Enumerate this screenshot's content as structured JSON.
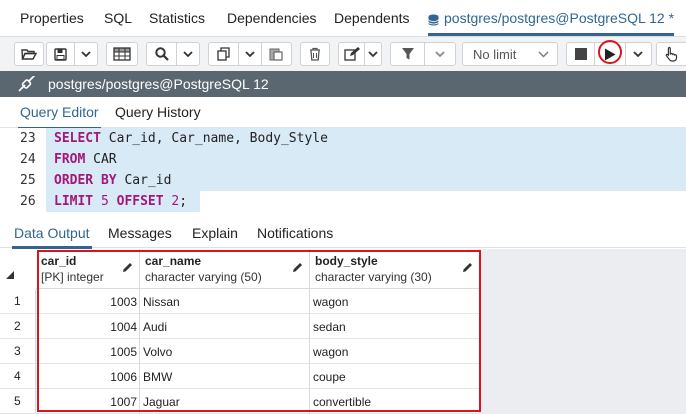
{
  "tabs": [
    {
      "label": "Properties"
    },
    {
      "label": "SQL"
    },
    {
      "label": "Statistics"
    },
    {
      "label": "Dependencies"
    },
    {
      "label": "Dependents"
    },
    {
      "label": "postgres/postgres@PostgreSQL 12 *"
    }
  ],
  "toolbar": {
    "limit_label": "No limit",
    "icons": [
      "open-file-icon",
      "save-icon",
      "save-dropdown-icon",
      "table-grid-icon",
      "search-icon",
      "search-dropdown-icon",
      "copy-icon",
      "copy-dropdown-icon",
      "paste-icon",
      "delete-icon",
      "edit-icon",
      "edit-dropdown-icon",
      "filter-icon",
      "filter-dropdown-icon",
      "stop-icon",
      "execute-icon",
      "execute-dropdown-icon",
      "pointer-icon"
    ]
  },
  "connection": {
    "label": "postgres/postgres@PostgreSQL 12"
  },
  "editor_tabs": [
    {
      "label": "Query Editor"
    },
    {
      "label": "Query History"
    }
  ],
  "editor": {
    "lines": [
      {
        "number": "23",
        "tokens": [
          {
            "kw": "SELECT"
          },
          {
            "t": " Car_id, Car_name, Body_Style"
          }
        ]
      },
      {
        "number": "24",
        "tokens": [
          {
            "kw": "FROM"
          },
          {
            "t": " CAR"
          }
        ]
      },
      {
        "number": "25",
        "tokens": [
          {
            "kw": "ORDER BY"
          },
          {
            "t": " Car_id"
          }
        ]
      },
      {
        "number": "26",
        "tokens": [
          {
            "kw": "LIMIT"
          },
          {
            "t": " "
          },
          {
            "n": "5"
          },
          {
            "t": " "
          },
          {
            "kw": "OFFSET"
          },
          {
            "t": " "
          },
          {
            "n": "2"
          },
          {
            "t": ";"
          }
        ]
      }
    ]
  },
  "output_tabs": [
    {
      "label": "Data Output"
    },
    {
      "label": "Messages"
    },
    {
      "label": "Explain"
    },
    {
      "label": "Notifications"
    }
  ],
  "grid": {
    "columns": [
      {
        "name": "car_id",
        "type": "[PK] integer"
      },
      {
        "name": "car_name",
        "type": "character varying (50)"
      },
      {
        "name": "body_style",
        "type": "character varying (30)"
      }
    ],
    "rows": [
      {
        "n": "1",
        "car_id": "1003",
        "car_name": "Nissan",
        "body_style": "wagon"
      },
      {
        "n": "2",
        "car_id": "1004",
        "car_name": "Audi",
        "body_style": "sedan"
      },
      {
        "n": "3",
        "car_id": "1005",
        "car_name": "Volvo",
        "body_style": "wagon"
      },
      {
        "n": "4",
        "car_id": "1006",
        "car_name": "BMW",
        "body_style": "coupe"
      },
      {
        "n": "5",
        "car_id": "1007",
        "car_name": "Jaguar",
        "body_style": "convertible"
      }
    ]
  },
  "colors": {
    "accent": "#326690",
    "highlight": "#d9141c",
    "connection_bar": "#5b6770",
    "keyword": "#a2187a",
    "selection": "#d8eaf6"
  }
}
